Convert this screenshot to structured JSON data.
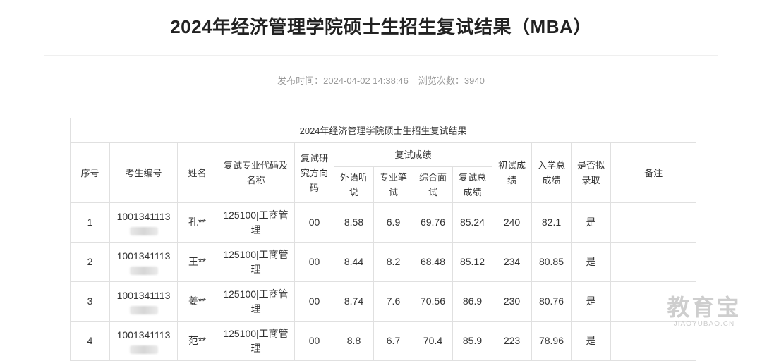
{
  "page": {
    "title": "2024年经济管理学院硕士生招生复试结果（MBA）",
    "meta_publish": "发布时间：2024-04-02 14:38:46",
    "meta_views": "浏览次数：3940"
  },
  "table": {
    "caption": "2024年经济管理学院硕士生招生复试结果",
    "headers": {
      "seq": "序号",
      "exam_id": "考生编号",
      "name": "姓名",
      "major": "复试专业代码及名称",
      "direction": "复试研究方向码",
      "retest_group": "复试成绩",
      "foreign": "外语听说",
      "professional": "专业笔试",
      "interview": "综合面试",
      "retest_total": "复试总成绩",
      "prelim": "初试成绩",
      "admit_total": "入学总成绩",
      "admit": "是否拟录取",
      "remark": "备注"
    },
    "rows": [
      {
        "seq": "1",
        "exam_id": "1001341113",
        "name": "孔**",
        "major": "125100|工商管理",
        "direction": "00",
        "foreign": "8.58",
        "professional": "6.9",
        "interview": "69.76",
        "retest_total": "85.24",
        "prelim": "240",
        "admit_total": "82.1",
        "admit": "是",
        "remark": ""
      },
      {
        "seq": "2",
        "exam_id": "1001341113",
        "name": "王**",
        "major": "125100|工商管理",
        "direction": "00",
        "foreign": "8.44",
        "professional": "8.2",
        "interview": "68.48",
        "retest_total": "85.12",
        "prelim": "234",
        "admit_total": "80.85",
        "admit": "是",
        "remark": ""
      },
      {
        "seq": "3",
        "exam_id": "1001341113",
        "name": "姜**",
        "major": "125100|工商管理",
        "direction": "00",
        "foreign": "8.74",
        "professional": "7.6",
        "interview": "70.56",
        "retest_total": "86.9",
        "prelim": "230",
        "admit_total": "80.76",
        "admit": "是",
        "remark": ""
      },
      {
        "seq": "4",
        "exam_id": "1001341113",
        "name": "范**",
        "major": "125100|工商管理",
        "direction": "00",
        "foreign": "8.8",
        "professional": "6.7",
        "interview": "70.4",
        "retest_total": "85.9",
        "prelim": "223",
        "admit_total": "78.96",
        "admit": "是",
        "remark": ""
      }
    ]
  },
  "watermark": {
    "logo": "教育宝",
    "url": "JIAOYUBAO.CN"
  }
}
